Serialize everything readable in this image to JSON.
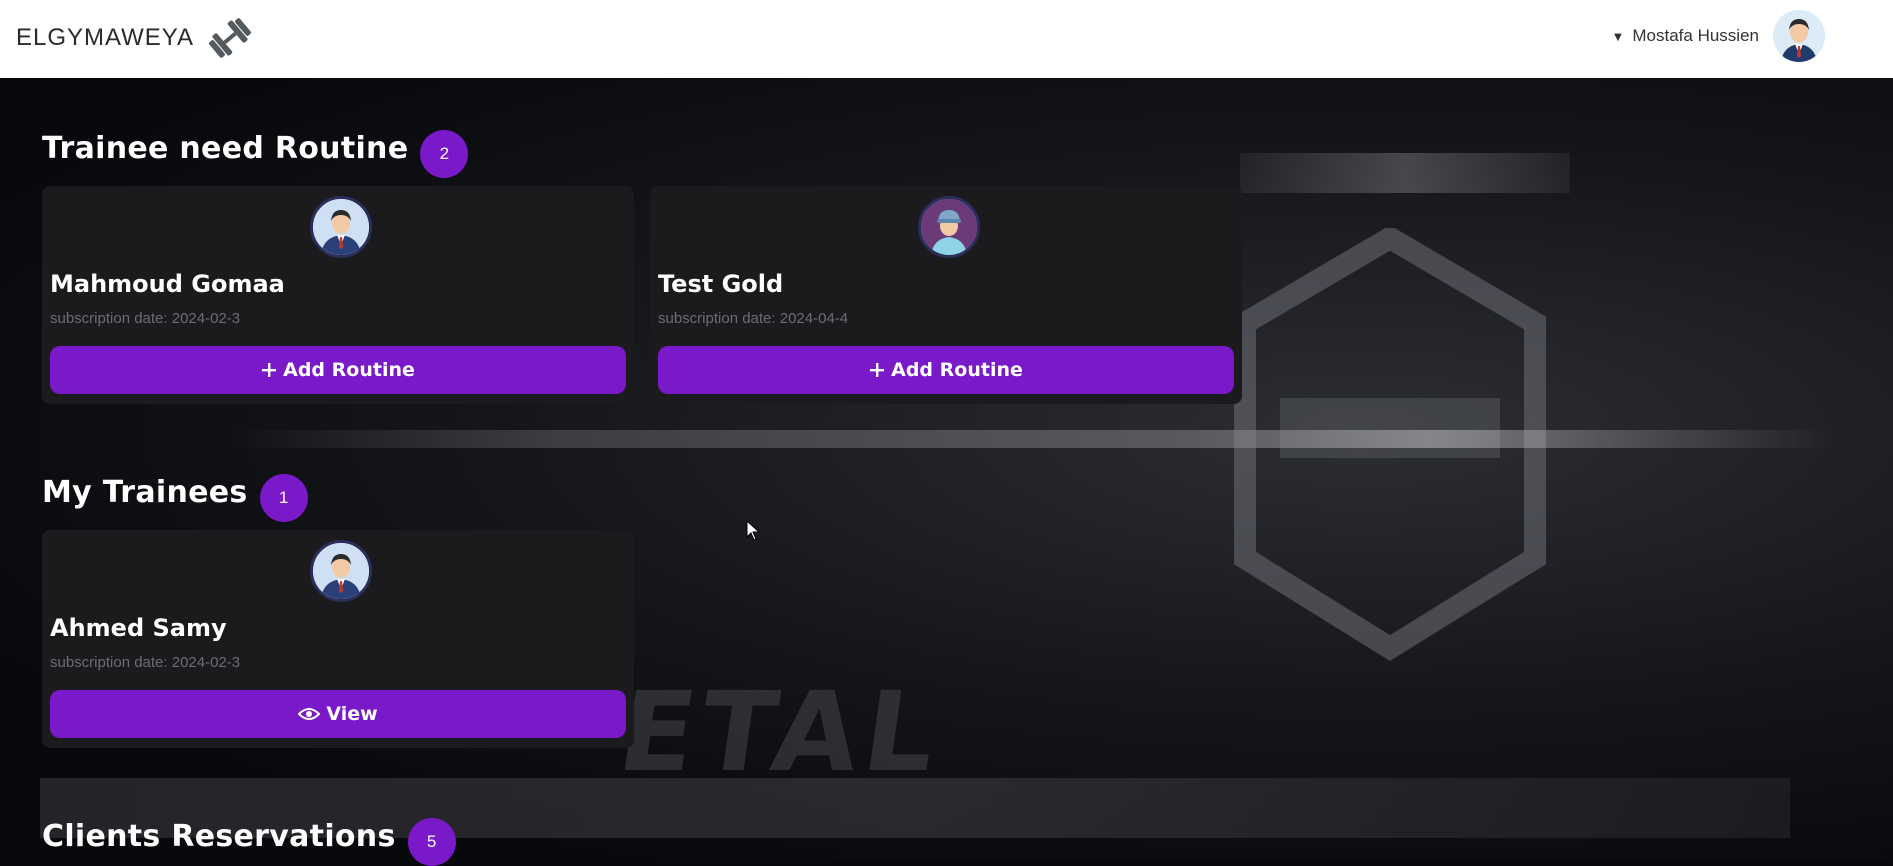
{
  "navbar": {
    "brand": "ELGYMAWEYA",
    "brand_logo_icon": "dumbbell-icon",
    "caret_icon": "caret-down-icon",
    "user_name": "Mostafa Hussien"
  },
  "sections": {
    "need_routine": {
      "title": "Trainee need Routine",
      "count": "2",
      "cards": [
        {
          "name": "Mahmoud Gomaa",
          "subscription": "subscription date: 2024-02-3",
          "button": "Add Routine",
          "button_icon": "plus-icon",
          "avatar": "male-avatar"
        },
        {
          "name": "Test Gold",
          "subscription": "subscription date: 2024-04-4",
          "button": "Add Routine",
          "button_icon": "plus-icon",
          "avatar": "cap-avatar"
        }
      ]
    },
    "my_trainees": {
      "title": "My Trainees",
      "count": "1",
      "cards": [
        {
          "name": "Ahmed Samy",
          "subscription": "subscription date: 2024-02-3",
          "button": "View",
          "button_icon": "eye-icon",
          "avatar": "male-avatar"
        }
      ]
    },
    "reservations": {
      "title": "Clients Reservations",
      "count": "5"
    }
  },
  "colors": {
    "accent": "#7a19c9",
    "card": "#1b1b1e",
    "page": "#08090c"
  }
}
